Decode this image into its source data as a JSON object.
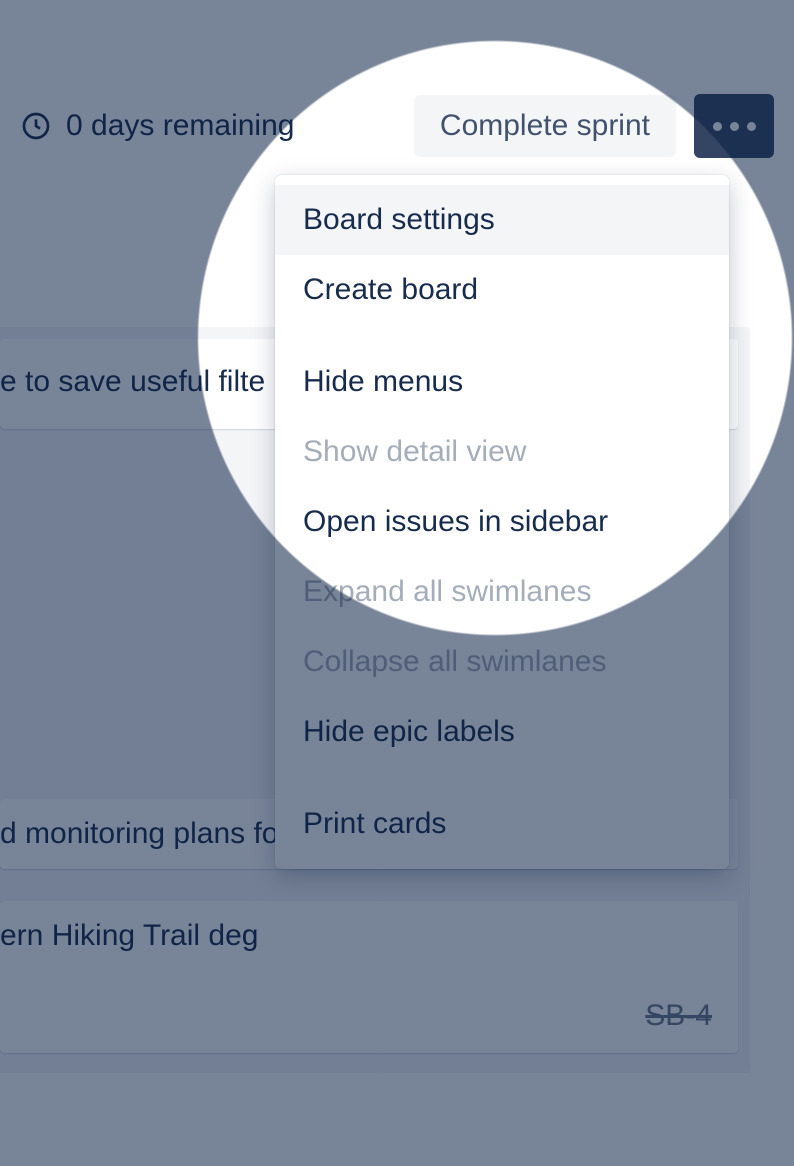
{
  "header": {
    "remaining_label": "0 days remaining",
    "complete_sprint_label": "Complete sprint"
  },
  "menu": {
    "items": [
      {
        "label": "Board settings",
        "enabled": true,
        "hover": true
      },
      {
        "label": "Create board",
        "enabled": true,
        "hover": false
      },
      {
        "sep": true
      },
      {
        "label": "Hide menus",
        "enabled": true,
        "hover": false
      },
      {
        "label": "Show detail view",
        "enabled": false,
        "hover": false
      },
      {
        "label": "Open issues in sidebar",
        "enabled": true,
        "hover": false
      },
      {
        "label": "Expand all swimlanes",
        "enabled": false,
        "hover": false
      },
      {
        "label": "Collapse all swimlanes",
        "enabled": false,
        "hover": false
      },
      {
        "label": "Hide epic labels",
        "enabled": true,
        "hover": false
      },
      {
        "sep": true
      },
      {
        "label": "Print cards",
        "enabled": true,
        "hover": false
      }
    ]
  },
  "cards": {
    "c1_text": "e to save useful filte",
    "c2_text": "d monitoring plans for",
    "c3_text": "ern Hiking Trail deg",
    "c3_key": "SB-4"
  }
}
